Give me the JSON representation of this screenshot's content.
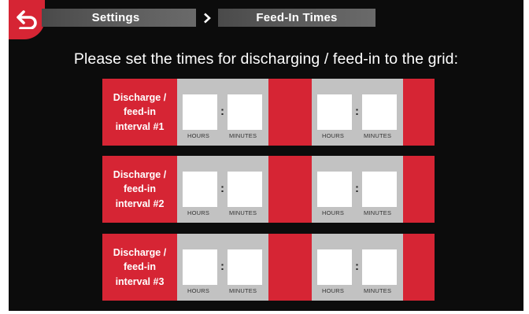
{
  "header": {
    "back_icon": "back-arrow-icon",
    "breadcrumb": {
      "parent": "Settings",
      "separator_icon": "chevron-right-icon",
      "current": "Feed-In Times"
    }
  },
  "prompt": "Please set the times for discharging / feed-in to the grid:",
  "units": {
    "hours": "HOURS",
    "minutes": "MINUTES"
  },
  "separator": ":",
  "intervals": [
    {
      "label_line1": "Discharge /",
      "label_line2": "feed-in",
      "label_line3": "interval #1",
      "start": {
        "hours": "",
        "minutes": ""
      },
      "end": {
        "hours": "",
        "minutes": ""
      }
    },
    {
      "label_line1": "Discharge /",
      "label_line2": "feed-in",
      "label_line3": "interval #2",
      "start": {
        "hours": "",
        "minutes": ""
      },
      "end": {
        "hours": "",
        "minutes": ""
      }
    },
    {
      "label_line1": "Discharge /",
      "label_line2": "feed-in",
      "label_line3": "interval #3",
      "start": {
        "hours": "",
        "minutes": ""
      },
      "end": {
        "hours": "",
        "minutes": ""
      }
    }
  ],
  "colors": {
    "accent": "#d62534",
    "background": "#0c0c0c",
    "panel": "#c2c2c2",
    "breadcrumb": "#5c5c5c"
  }
}
